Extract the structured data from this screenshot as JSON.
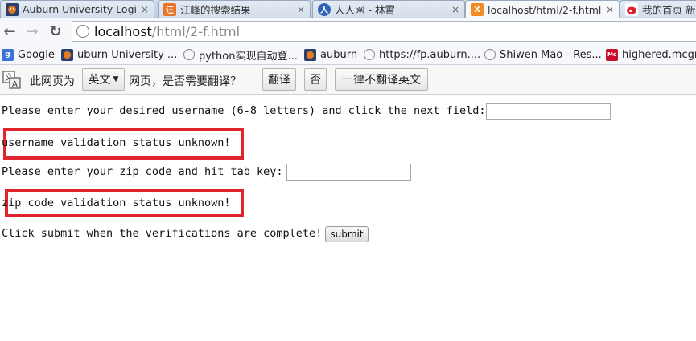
{
  "tabs": [
    {
      "label": "Auburn University Login",
      "icon": "auburn-tiger-icon",
      "close": "×",
      "active": false
    },
    {
      "label": "汪峰的搜索结果",
      "icon": "search-result-icon",
      "close": "×",
      "active": false
    },
    {
      "label": "人人网 - 林霄",
      "icon": "renren-icon",
      "close": "×",
      "active": false
    },
    {
      "label": "localhost/html/2-f.html",
      "icon": "xampp-icon",
      "close": "×",
      "active": true
    },
    {
      "label": "我的首页 新浪",
      "icon": "weibo-icon",
      "close": "",
      "active": false
    }
  ],
  "nav": {
    "back": "←",
    "forward": "→",
    "reload": "↻"
  },
  "address": {
    "host": "localhost",
    "path": "/html/2-f.html"
  },
  "bookmarks": [
    {
      "label": "Google",
      "icon": "google-icon"
    },
    {
      "label": "uburn University ...",
      "icon": "auburn-tiger-icon"
    },
    {
      "label": "python实现自动登...",
      "icon": "globe-icon"
    },
    {
      "label": "auburn",
      "icon": "auburn-tiger-icon"
    },
    {
      "label": "https://fp.auburn....",
      "icon": "globe-icon"
    },
    {
      "label": "Shiwen Mao - Res...",
      "icon": "globe-icon"
    },
    {
      "label": "highered.mcgraw",
      "icon": "mcgraw-hill-icon"
    }
  ],
  "translate_bar": {
    "prefix": "此网页为",
    "language": "英文",
    "question": "网页，是否需要翻译？",
    "translate_button": "翻译",
    "no_button": "否",
    "never_button": "一律不翻译英文"
  },
  "page": {
    "username_prompt": "Please enter your desired username (6-8 letters) and click the next field:",
    "username_value": "",
    "username_status": "username validation status unknown!",
    "zip_prompt": "Please enter your zip code and hit tab key:",
    "zip_value": "",
    "zip_status": "zip code validation status unknown!",
    "submit_prompt": "Click submit when the verifications are complete!",
    "submit_label": "submit"
  },
  "colors": {
    "highlight_border": "#e0242b",
    "tab_active": "#f6f8fb"
  }
}
